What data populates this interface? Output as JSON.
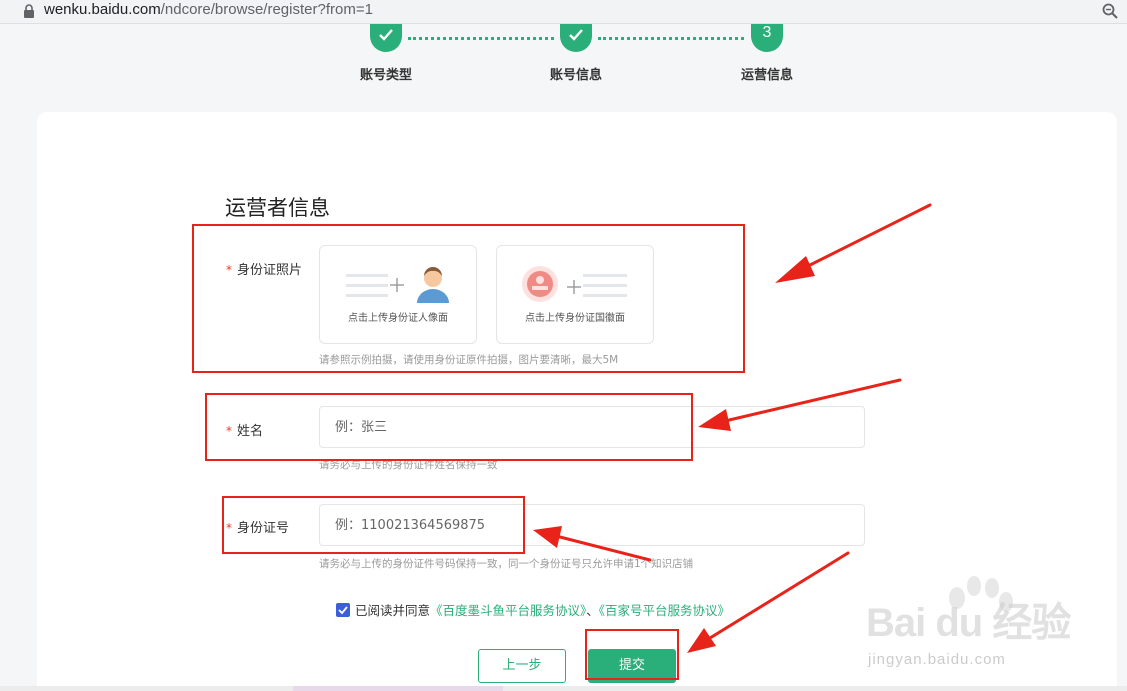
{
  "browser": {
    "url_host": "wenku.baidu.com",
    "url_path": "/ndcore/browse/register?from=1"
  },
  "steps": [
    {
      "label": "账号类型",
      "state": "done"
    },
    {
      "label": "账号信息",
      "state": "done"
    },
    {
      "label": "运营信息",
      "state": "current",
      "number": "3"
    }
  ],
  "form": {
    "title": "运营者信息",
    "required_mark": "*",
    "id_photo": {
      "label": "身份证照片",
      "front_caption": "点击上传身份证人像面",
      "back_caption": "点击上传身份证国徽面",
      "tip": "请参照示例拍摄，请使用身份证原件拍摄，图片要清晰，最大5M"
    },
    "name": {
      "label": "姓名",
      "placeholder": "例：张三",
      "tip": "请务必与上传的身份证件姓名保持一致"
    },
    "id_number": {
      "label": "身份证号",
      "placeholder": "例：110021364569875",
      "tip": "请务必与上传的身份证件号码保持一致，同一个身份证号只允许申请1个知识店铺"
    },
    "agreement": {
      "prefix": "已阅读并同意",
      "link1": "《百度墨斗鱼平台服务协议》",
      "separator": "、",
      "link2": "《百家号平台服务协议》",
      "checked": true
    },
    "buttons": {
      "prev": "上一步",
      "submit": "提交"
    }
  },
  "watermark": {
    "brand": "Bai du 经验",
    "url": "jingyan.baidu.com"
  },
  "colors": {
    "accent": "#2aae7a",
    "annotation": "#e8231a",
    "checkbox": "#3b5fd9"
  }
}
